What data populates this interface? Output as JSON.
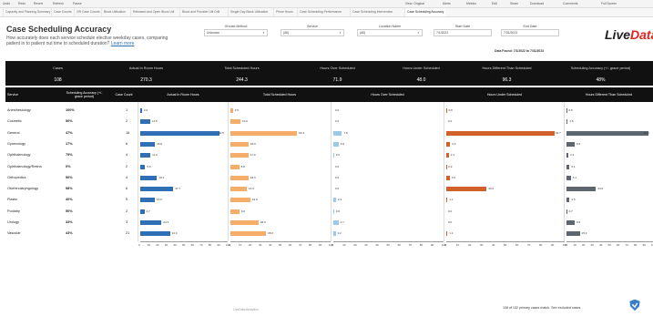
{
  "toolbar": {
    "left_items": [
      "Undo",
      "Redo",
      "Revert",
      "Refresh",
      "Pause"
    ],
    "right_items": [
      "View: Original",
      "Alerts",
      "Metrics",
      "Edit",
      "Share",
      "Download",
      "Comments",
      "Full Screen"
    ]
  },
  "tabs": [
    "Capacity and Planning Summary",
    "Case Counts",
    "OR Case Counts",
    "Block Utilization",
    "Released and Open Block Util",
    "Block and Provider Util Drill",
    "Single Day Block Utilization",
    "Prime Hours",
    "Case Scheduling Performance",
    "Case Scheduling Intervention",
    "Case Scheduling Accuracy"
  ],
  "header": {
    "title": "Case Scheduling Accuracy",
    "subtitle": "How accurately does each service schedule elective weekday cases, comparing patient in to patient out time to scheduled duration?",
    "learn_more": "Learn more"
  },
  "filters": [
    {
      "label": "Grouse Method",
      "value": "Unknown"
    },
    {
      "label": "Service",
      "value": "(All)"
    },
    {
      "label": "Location Name",
      "value": "(All)"
    },
    {
      "label": "Start Date",
      "value": "7/1/2022"
    },
    {
      "label": "End Date",
      "value": "7/31/2023"
    }
  ],
  "logo": {
    "part1": "Live",
    "part2": "Data"
  },
  "date_found": "Data Found: 7/1/2022 to 7/31/2023",
  "summary": {
    "headers": [
      "Cases",
      "Actual In Room Hours",
      "Total Scheduled Hours",
      "Hours Over Scheduled",
      "Hours Under Scheduled",
      "Hours Different Than Scheduled",
      "Scheduling Accuracy (+/- grace period)"
    ],
    "values": [
      "108",
      "270.3",
      "244.3",
      "71.9",
      "48.0",
      "96.3",
      "48%"
    ]
  },
  "table": {
    "headers": {
      "service": "Service",
      "accuracy": "Scheduling Accuracy (+/- grace period)",
      "count": "Case Count",
      "actual": "Actual In Room Hours",
      "total": "Total Scheduled Hours",
      "over": "Hours Over Scheduled",
      "under": "Hours Under Scheduled",
      "diff": "Hours Different Than Scheduled"
    },
    "rows": [
      {
        "service": "Anesthesiology",
        "accuracy": "100%",
        "count": "1",
        "actual": 2.0,
        "total": 2.5,
        "over": 0.0,
        "under": 0.5,
        "diff": 0.5
      },
      {
        "service": "Cosmetic",
        "accuracy": "50%",
        "count": "2",
        "actual": 11.5,
        "total": 10.0,
        "over": 0.0,
        "under": 0.0,
        "diff": 1.5
      },
      {
        "service": "General",
        "accuracy": "47%",
        "count": "16",
        "actual": 90.5,
        "total": 66.4,
        "over": 7.8,
        "under": 91.7,
        "diff": 94.6
      },
      {
        "service": "Gynecology",
        "accuracy": "17%",
        "count": "6",
        "actual": 16.8,
        "total": 18.0,
        "over": 4.8,
        "under": 3.3,
        "diff": 9.5
      },
      {
        "service": "Ophthalmology",
        "accuracy": "75%",
        "count": "4",
        "actual": 11.6,
        "total": 17.9,
        "over": 0.6,
        "under": 2.1,
        "diff": 2.3
      },
      {
        "service": "Ophthalmology/Retina",
        "accuracy": "0%",
        "count": "2",
        "actual": 5.6,
        "total": 8.8,
        "over": 0.0,
        "under": 0.2,
        "diff": 3.4
      },
      {
        "service": "Orthopedics",
        "accuracy": "50%",
        "count": "4",
        "actual": 19.2,
        "total": 18.0,
        "over": 0.0,
        "under": 3.0,
        "diff": 5.1
      },
      {
        "service": "Otorhinolaryngology",
        "accuracy": "58%",
        "count": "6",
        "actual": 37.7,
        "total": 16.3,
        "over": 0.0,
        "under": 34.0,
        "diff": 34.0
      },
      {
        "service": "Plastic",
        "accuracy": "40%",
        "count": "5",
        "actual": 16.6,
        "total": 19.9,
        "over": 2.4,
        "under": 1.1,
        "diff": 3.5
      },
      {
        "service": "Podiatry",
        "accuracy": "50%",
        "count": "2",
        "actual": 4.7,
        "total": 9.0,
        "over": 0.6,
        "under": 0.0,
        "diff": 0.7
      },
      {
        "service": "Urology",
        "accuracy": "33%",
        "count": "3",
        "actual": 24.3,
        "total": 28.0,
        "over": 4.7,
        "under": 0.0,
        "diff": 9.5
      },
      {
        "service": "Vascular",
        "accuracy": "43%",
        "count": "21",
        "actual": 34.0,
        "total": 35.6,
        "over": 2.2,
        "under": 1.1,
        "diff": 15.3
      }
    ]
  },
  "axis_ticks": [
    "0",
    "10",
    "20",
    "30",
    "40",
    "50",
    "60",
    "70",
    "80",
    "90",
    "100"
  ],
  "axis_max": 100,
  "colors": {
    "actual": "#2f6fb5",
    "total": "#f6ad6a",
    "over": "#9cc9ea",
    "under": "#d2602a",
    "diff": "#5d6670",
    "header_bg": "#111111"
  },
  "footer": {
    "mid": "LiveData Analytics",
    "right": "108 of 132 primary cases match. See excluded cases."
  }
}
